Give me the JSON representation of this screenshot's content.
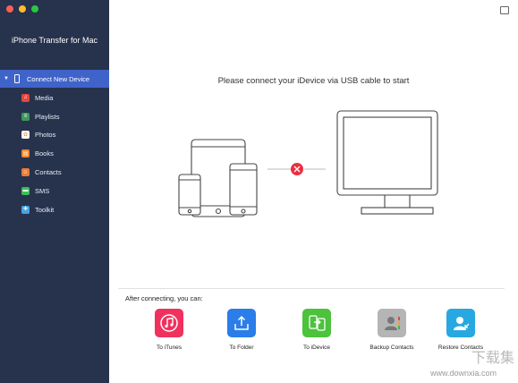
{
  "window": {
    "controls": [
      {
        "name": "close",
        "color": "#ff5f57"
      },
      {
        "name": "minimize",
        "color": "#febc2e"
      },
      {
        "name": "zoom",
        "color": "#28c840"
      }
    ]
  },
  "sidebar": {
    "app_title": "iPhone Transfer for Mac",
    "active_item": {
      "label": "Connect New Device",
      "icon": "phone-icon"
    },
    "items": [
      {
        "label": "Media",
        "icon": "music-note-icon",
        "color": "#e8453c",
        "glyph": "♫"
      },
      {
        "label": "Playlists",
        "icon": "playlist-icon",
        "color": "#3d9a5b",
        "glyph": "≡"
      },
      {
        "label": "Photos",
        "icon": "photos-icon",
        "color": "#f0a040",
        "glyph": "✿"
      },
      {
        "label": "Books",
        "icon": "books-icon",
        "color": "#f28a2e",
        "glyph": "▤"
      },
      {
        "label": "Contacts",
        "icon": "contacts-icon",
        "color": "#e87d3a",
        "glyph": "☺"
      },
      {
        "label": "SMS",
        "icon": "sms-icon",
        "color": "#3cbf5a",
        "glyph": "▬"
      },
      {
        "label": "Toolkit",
        "icon": "toolkit-icon",
        "color": "#4aa3e0",
        "glyph": "✚"
      }
    ]
  },
  "main": {
    "connect_message": "Please connect your iDevice via USB cable to start",
    "after_connecting": "After connecting, you can:",
    "actions": [
      {
        "label": "To iTunes",
        "icon": "itunes-icon",
        "color": "#f0315e"
      },
      {
        "label": "To Folder",
        "icon": "folder-export-icon",
        "color": "#2b7de9"
      },
      {
        "label": "To iDevice",
        "icon": "device-transfer-icon",
        "color": "#4cc23d"
      },
      {
        "label": "Backup Contacts",
        "icon": "backup-contacts-icon",
        "color": "#9a9a9a"
      },
      {
        "label": "Restore Contacts",
        "icon": "restore-contacts-icon",
        "color": "#28a8e0"
      }
    ]
  },
  "watermark": {
    "text": "下载集",
    "url": "www.downxia.com"
  }
}
